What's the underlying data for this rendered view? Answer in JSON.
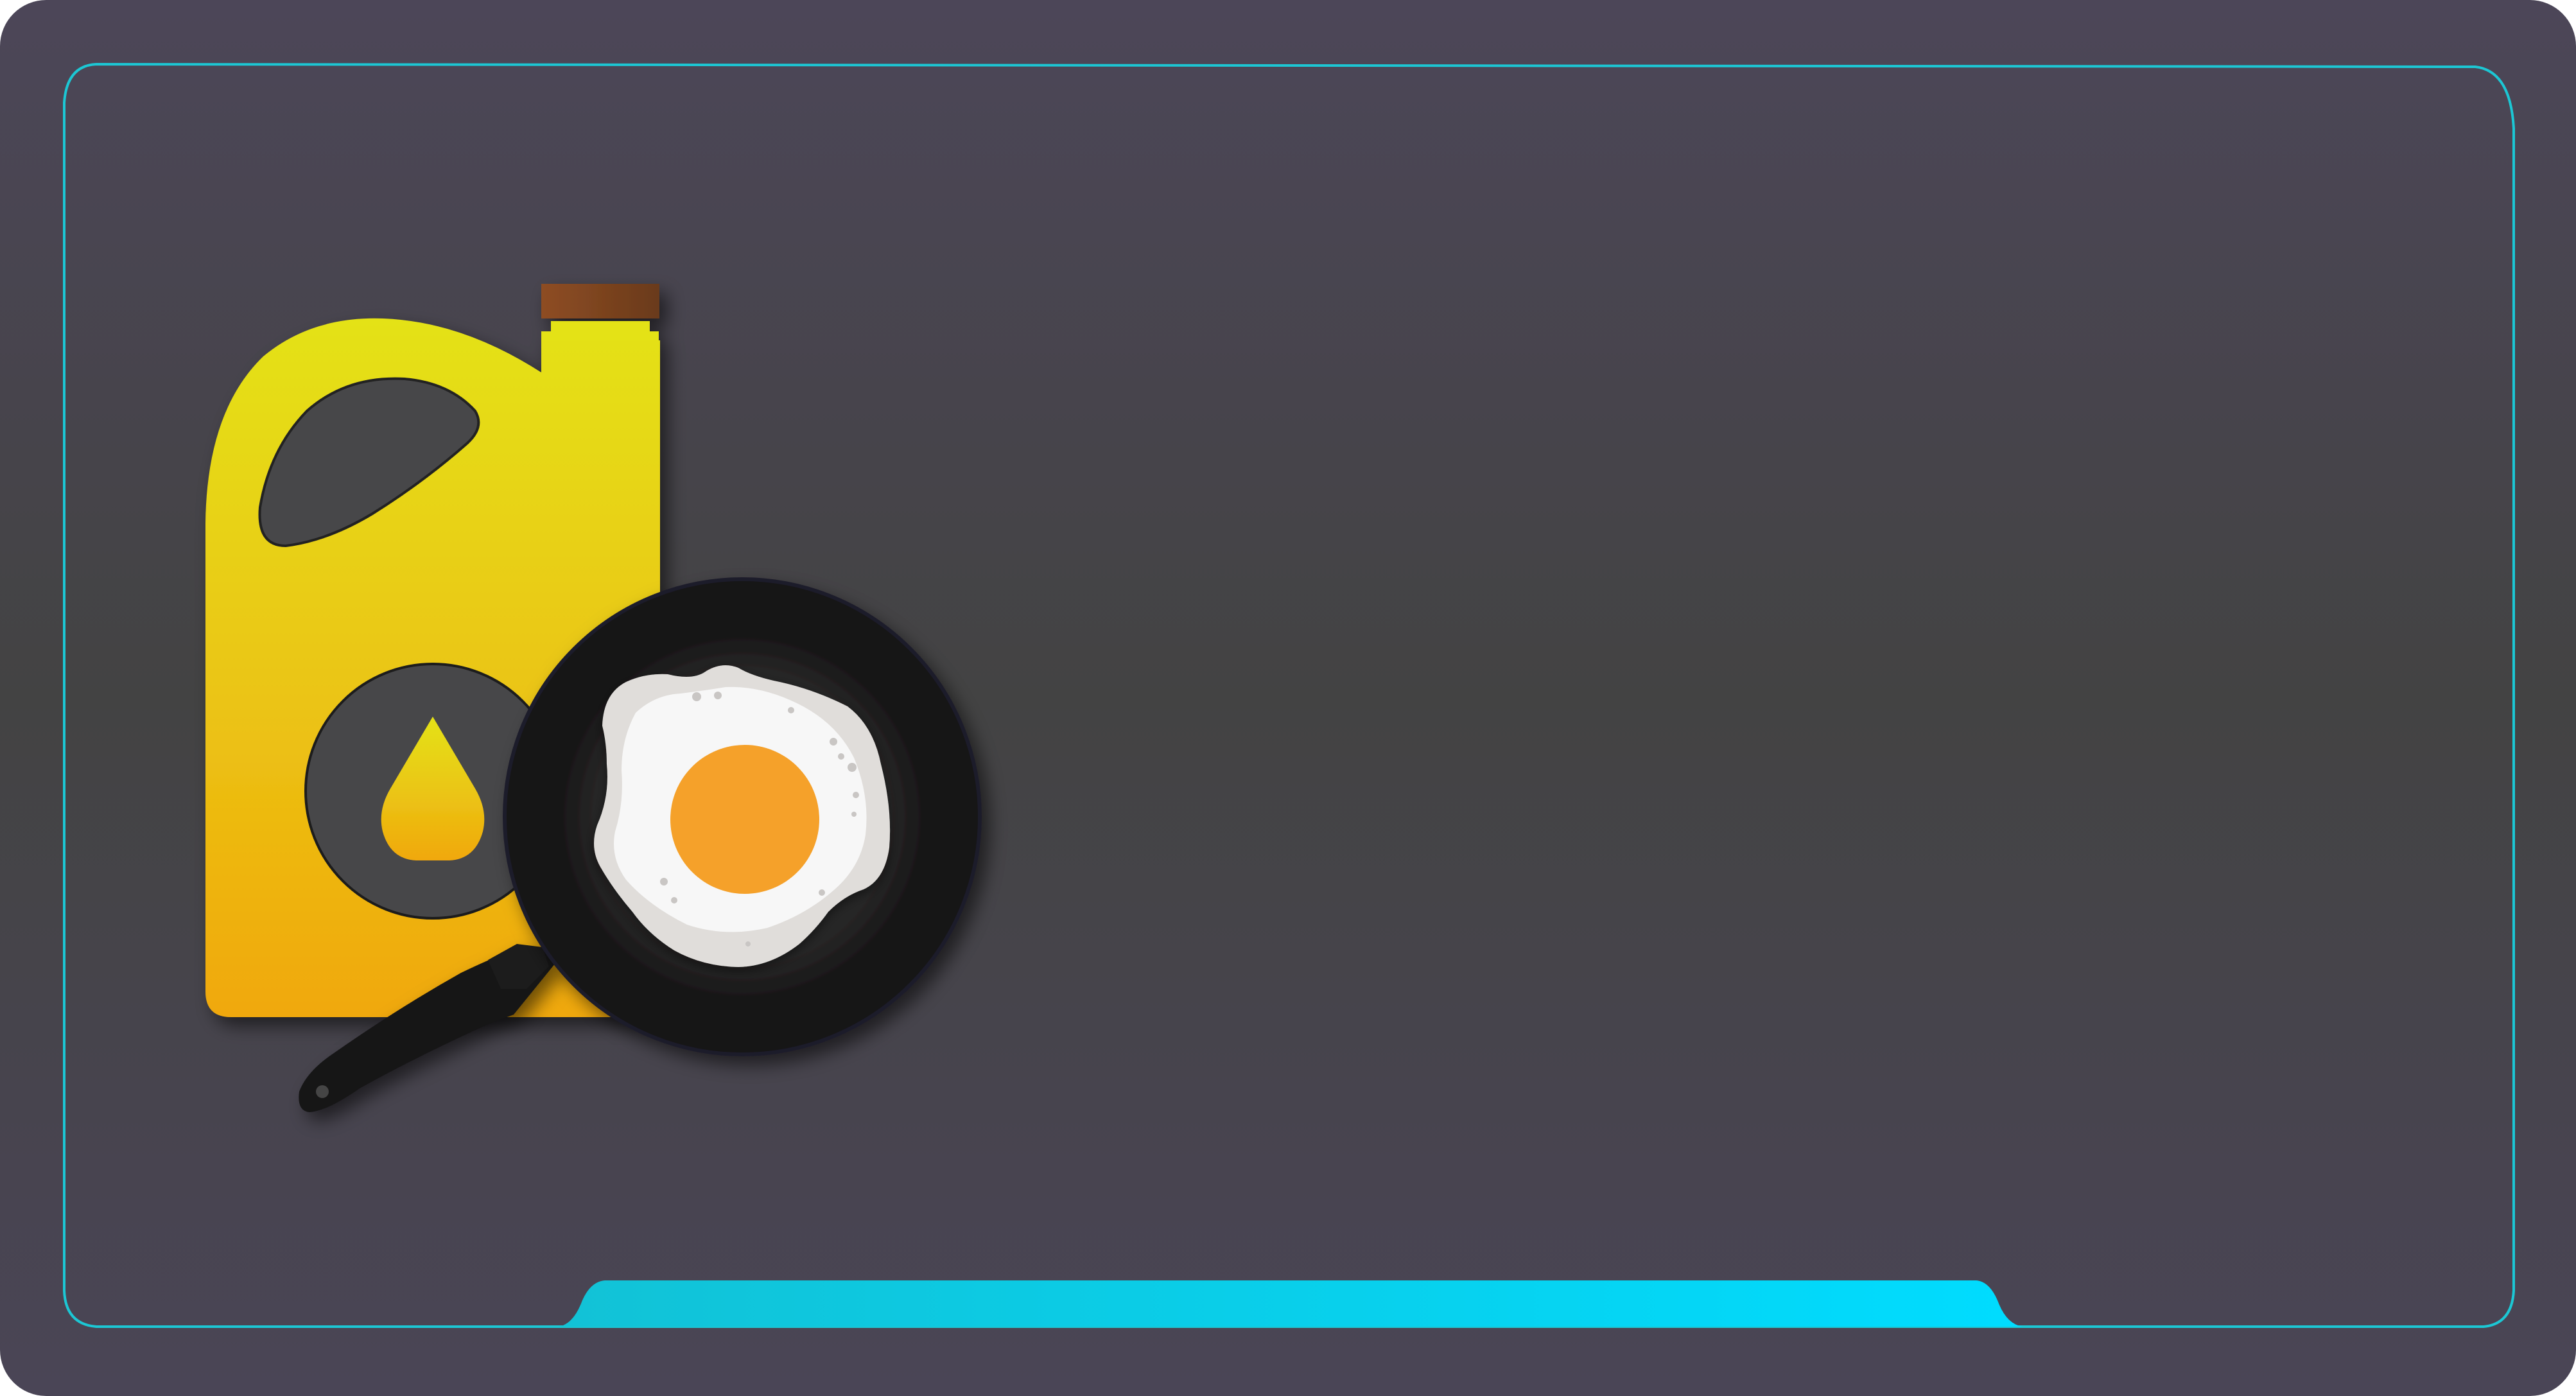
{
  "scene": {
    "description_text": "",
    "colors": {
      "page_background": "#ffffff",
      "panel_top": "#4c4658",
      "panel_middle": "#434343",
      "panel_bottom": "#4a4556",
      "frame_line": "#1cc7d4",
      "bottom_bar_start": "#12c2d6",
      "bottom_bar_end": "#00dcff",
      "jug_top": "#e4e218",
      "jug_bottom": "#f0a80a",
      "cap": "#8a4a22",
      "pan_outer": "#151415",
      "pan_inner": "#242424",
      "egg_white": "#f5f5f5",
      "egg_yolk": "#f5a12a"
    },
    "icons": [
      "oil-jug-icon",
      "oil-drop-icon",
      "frying-pan-icon",
      "fried-egg-icon"
    ]
  }
}
